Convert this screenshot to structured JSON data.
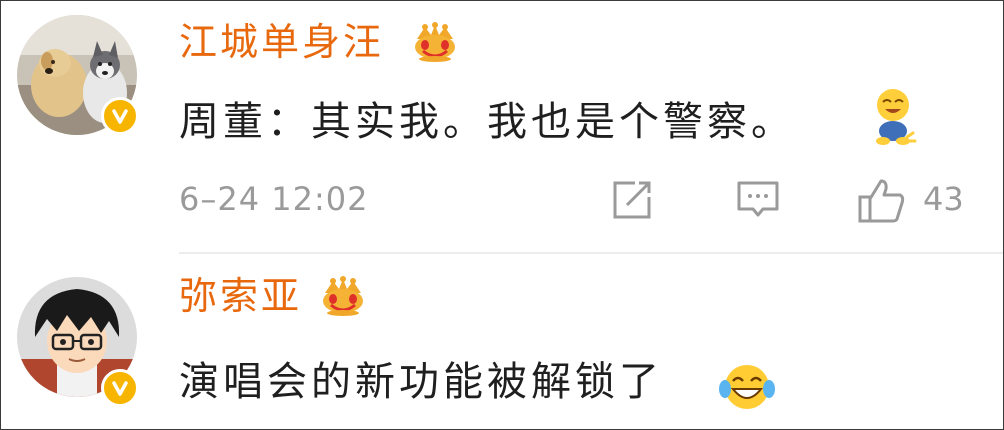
{
  "comments": [
    {
      "username": "江城单身汪",
      "text": "周董：其实我。我也是个警察。",
      "timestamp": "6–24 12:02",
      "likes": "43",
      "avatar_icon": "avatar-dogs-icon",
      "badge_icon": "verified-badge-icon",
      "vip_icon": "crown-icon",
      "emoji_icon": "laughing-sitting-emoji-icon"
    },
    {
      "username": "弥索亚",
      "text": "演唱会的新功能被解锁了",
      "avatar_icon": "avatar-anime-boy-icon",
      "badge_icon": "verified-badge-icon",
      "vip_icon": "crown-icon",
      "emoji_icon": "crying-laughing-emoji-icon"
    }
  ],
  "colors": {
    "username": "#e8680e",
    "text": "#1f1f1f",
    "meta": "#9a9a9a",
    "badge": "#f7b500",
    "divider": "#ececec"
  },
  "actions": [
    "share-icon",
    "reply-icon",
    "like-icon"
  ]
}
